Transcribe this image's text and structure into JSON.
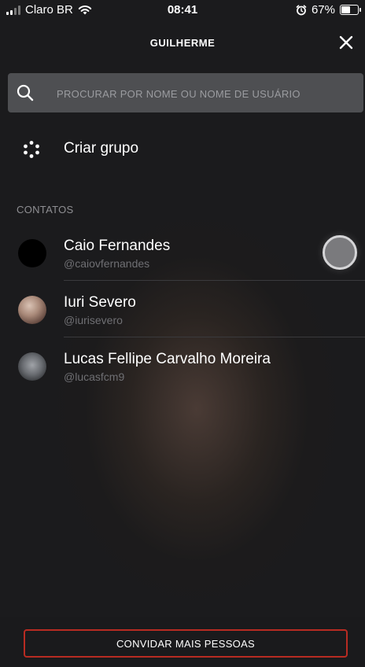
{
  "status_bar": {
    "carrier": "Claro BR",
    "time": "08:41",
    "battery": "67%",
    "battery_level": 0.67
  },
  "header": {
    "title": "GUILHERME",
    "close_icon": "close-icon"
  },
  "search": {
    "placeholder": "PROCURAR POR NOME OU NOME DE USUÁRIO",
    "value": ""
  },
  "create_group": {
    "label": "Criar grupo",
    "icon": "group-dots-icon"
  },
  "contacts_section": {
    "title": "CONTATOS",
    "items": [
      {
        "name": "Caio Fernandes",
        "username": "@caiovfernandes"
      },
      {
        "name": "Iuri Severo",
        "username": "@iurisevero"
      },
      {
        "name": "Lucas Fellipe Carvalho Moreira",
        "username": "@lucasfcm9"
      }
    ]
  },
  "footer": {
    "invite_label": "CONVIDAR MAIS PESSOAS"
  },
  "colors": {
    "background": "#1b1b1d",
    "search_bg": "#4e4f52",
    "accent_border": "#b82b22",
    "muted_text": "#8f8f93"
  }
}
